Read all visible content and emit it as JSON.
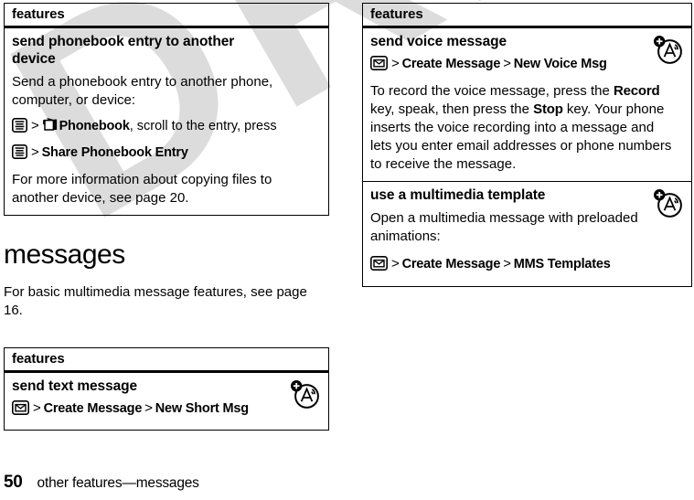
{
  "document": {
    "watermark": "DRAFT",
    "watermark_color": "#dcdcdc",
    "page_background": "#ffffff",
    "text_color": "#000000"
  },
  "left_column": {
    "table_top": {
      "header": "features",
      "rows": [
        {
          "title": "send phonebook entry to another device",
          "paragraph_1": "Send a phonebook entry to another phone, computer, or device:",
          "path": {
            "icon_1": "menu-key-icon",
            "sep_1": ">",
            "icon_2": "phonebook-icon",
            "item_1": "Phonebook",
            "trailing_1": ", scroll to the entry, press",
            "icon_3": "menu-key-icon",
            "sep_2": ">",
            "item_2": "Share Phonebook Entry"
          },
          "paragraph_2": "For more information about copying files to another device, see page 20."
        }
      ]
    },
    "section": {
      "heading": "messages",
      "paragraph": "For basic multimedia message features, see page 16."
    },
    "table_bottom": {
      "header": "features",
      "rows": [
        {
          "title": "send text message",
          "badge": "message-badge-icon",
          "path": {
            "icon_1": "envelope-key-icon",
            "sep_1": ">",
            "item_1": "Create Message",
            "sep_2": ">",
            "item_2": "New Short Msg"
          }
        }
      ]
    }
  },
  "right_column": {
    "table": {
      "header": "features",
      "rows": [
        {
          "title": "send voice message",
          "badge": "message-badge-icon",
          "path": {
            "icon_1": "envelope-key-icon",
            "sep_1": ">",
            "item_1": "Create Message",
            "sep_2": ">",
            "item_2": "New Voice Msg"
          },
          "body_part_1": "To record the voice message, press the ",
          "body_bold_1": "Record",
          "body_part_2": " key, speak, then press the ",
          "body_bold_2": "Stop",
          "body_part_3": " key. Your phone inserts the voice recording into a message and lets you enter email addresses or phone numbers to receive the message."
        },
        {
          "title": "use a multimedia template",
          "badge": "message-badge-icon",
          "paragraph": "Open a multimedia message with preloaded animations:",
          "path": {
            "icon_1": "envelope-key-icon",
            "sep_1": ">",
            "item_1": "Create Message",
            "sep_2": ">",
            "item_2": "MMS Templates"
          }
        }
      ]
    }
  },
  "footer": {
    "page_number": "50",
    "breadcrumb": "other features—messages"
  }
}
